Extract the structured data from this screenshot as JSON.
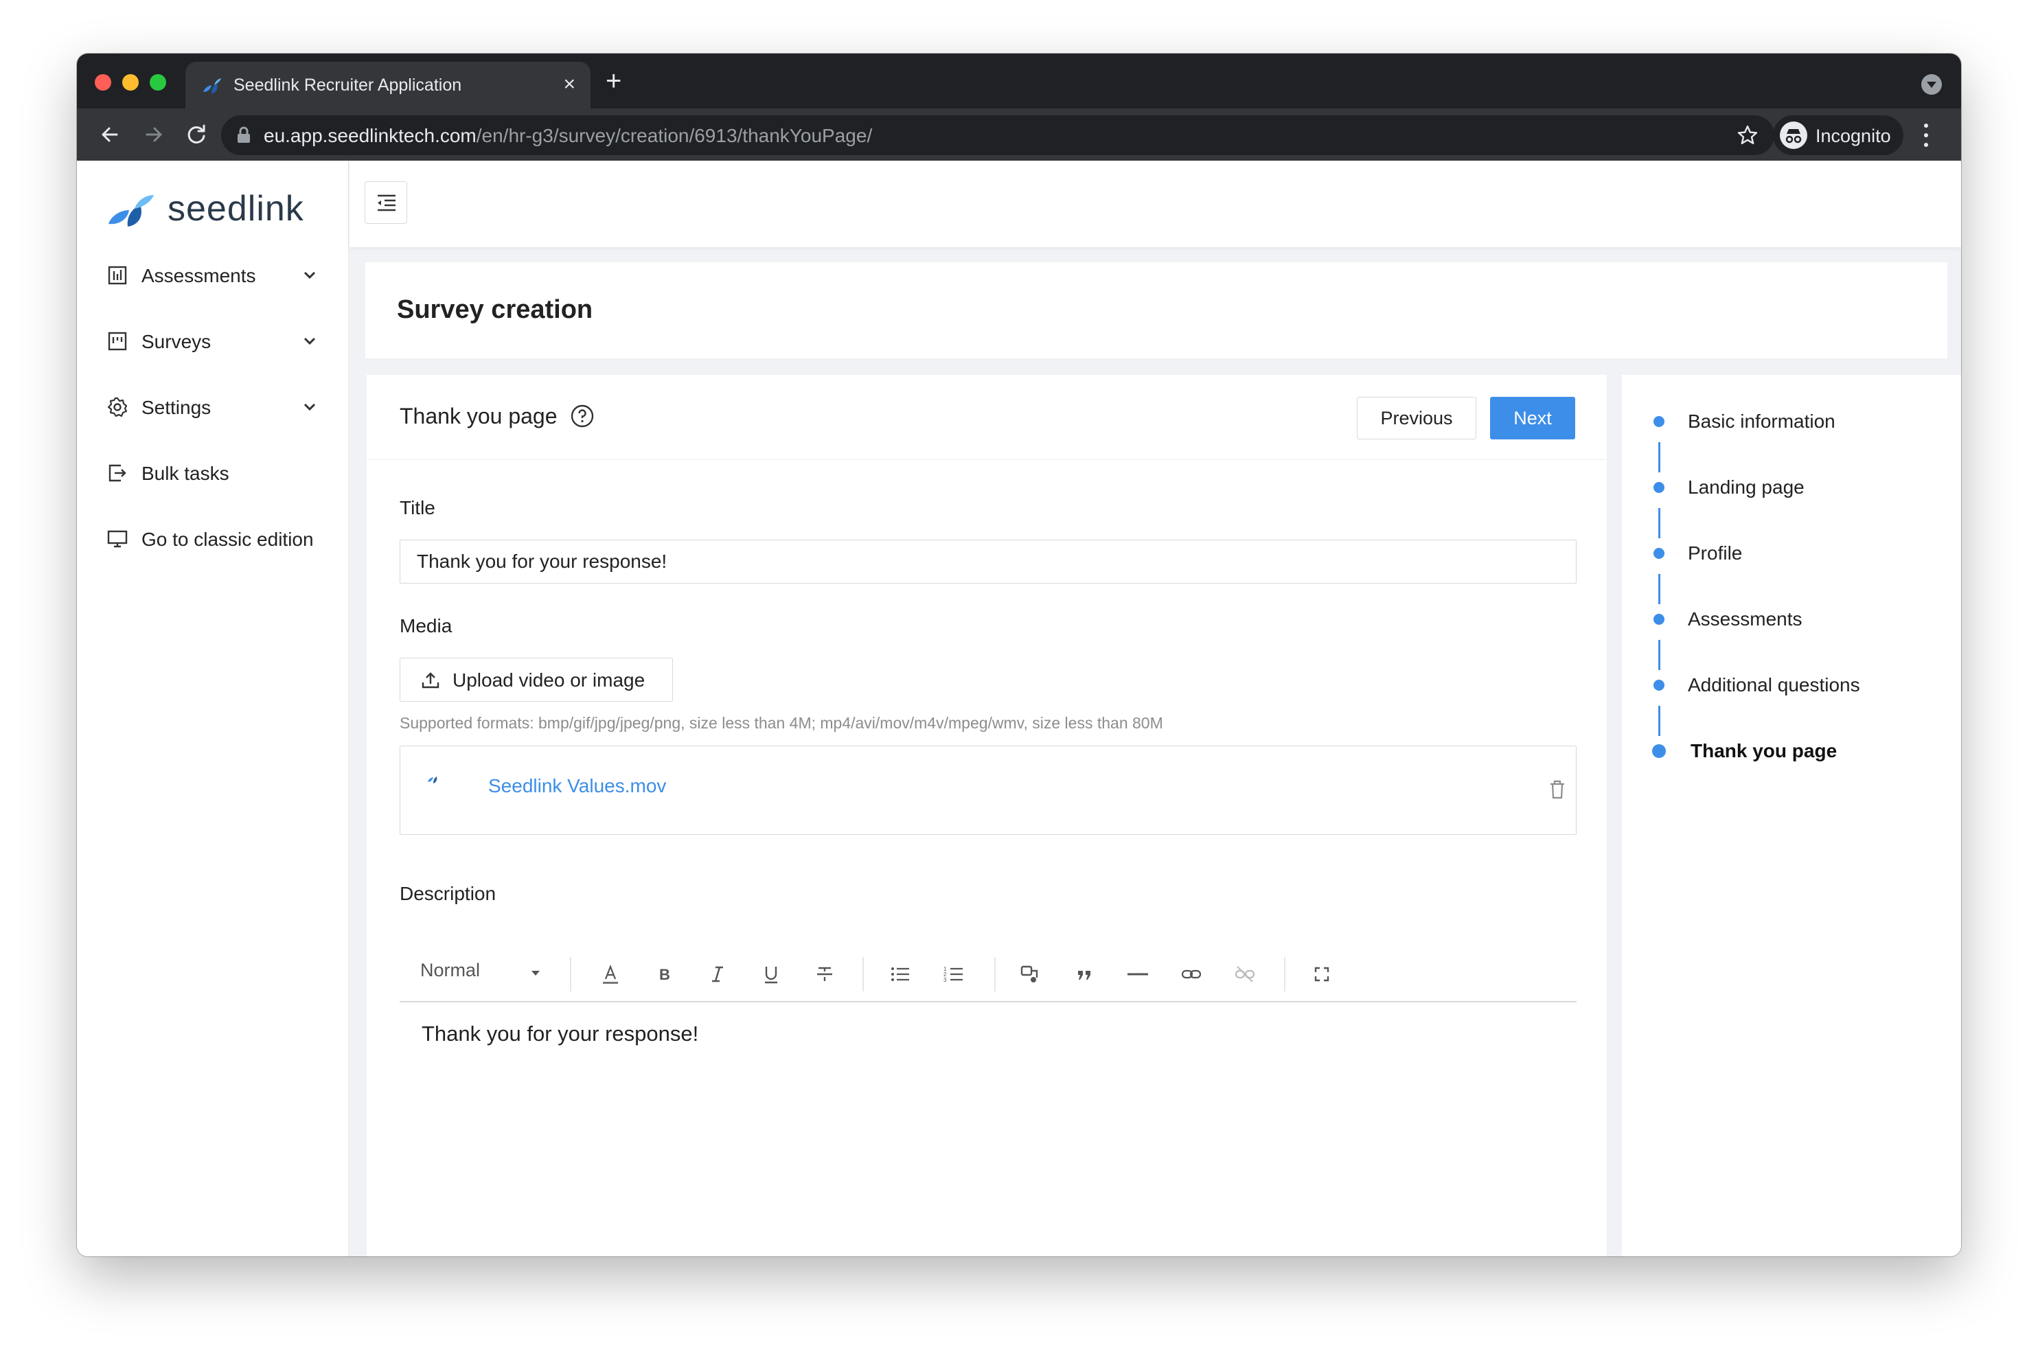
{
  "browser": {
    "tab_title": "Seedlink Recruiter Application",
    "url_host": "eu.app.seedlinktech.com",
    "url_path": "/en/hr-g3/survey/creation/6913/thankYouPage/",
    "profile_label": "Incognito"
  },
  "brand": {
    "name": "seedlink",
    "small_logo_text": "seedlink"
  },
  "sidebar": {
    "items": [
      {
        "label": "Assessments",
        "icon": "assessments-icon",
        "has_chevron": true
      },
      {
        "label": "Surveys",
        "icon": "surveys-icon",
        "has_chevron": true
      },
      {
        "label": "Settings",
        "icon": "gear-icon",
        "has_chevron": true
      },
      {
        "label": "Bulk tasks",
        "icon": "bulk-tasks-icon",
        "has_chevron": false
      },
      {
        "label": "Go to classic edition",
        "icon": "monitor-icon",
        "has_chevron": false
      }
    ]
  },
  "page": {
    "title": "Survey creation"
  },
  "card": {
    "title": "Thank you page",
    "previous_label": "Previous",
    "next_label": "Next",
    "title_field_label": "Title",
    "title_value": "Thank you for your response!",
    "media_label": "Media",
    "upload_label": "Upload video or image",
    "formats_hint": "Supported formats: bmp/gif/jpg/jpeg/png, size less than 4M; mp4/avi/mov/m4v/mpeg/wmv, size less than 80M",
    "file_name": "Seedlink Values.mov",
    "description_label": "Description",
    "editor": {
      "format_select": "Normal",
      "content": "Thank you for your response!"
    }
  },
  "steps": [
    {
      "label": "Basic information"
    },
    {
      "label": "Landing page"
    },
    {
      "label": "Profile"
    },
    {
      "label": "Assessments"
    },
    {
      "label": "Additional questions"
    },
    {
      "label": "Thank you page",
      "current": true
    }
  ],
  "colors": {
    "accent": "#3d8ee8",
    "chrome_dark": "#202124",
    "chrome_toolbar": "#35363a"
  }
}
